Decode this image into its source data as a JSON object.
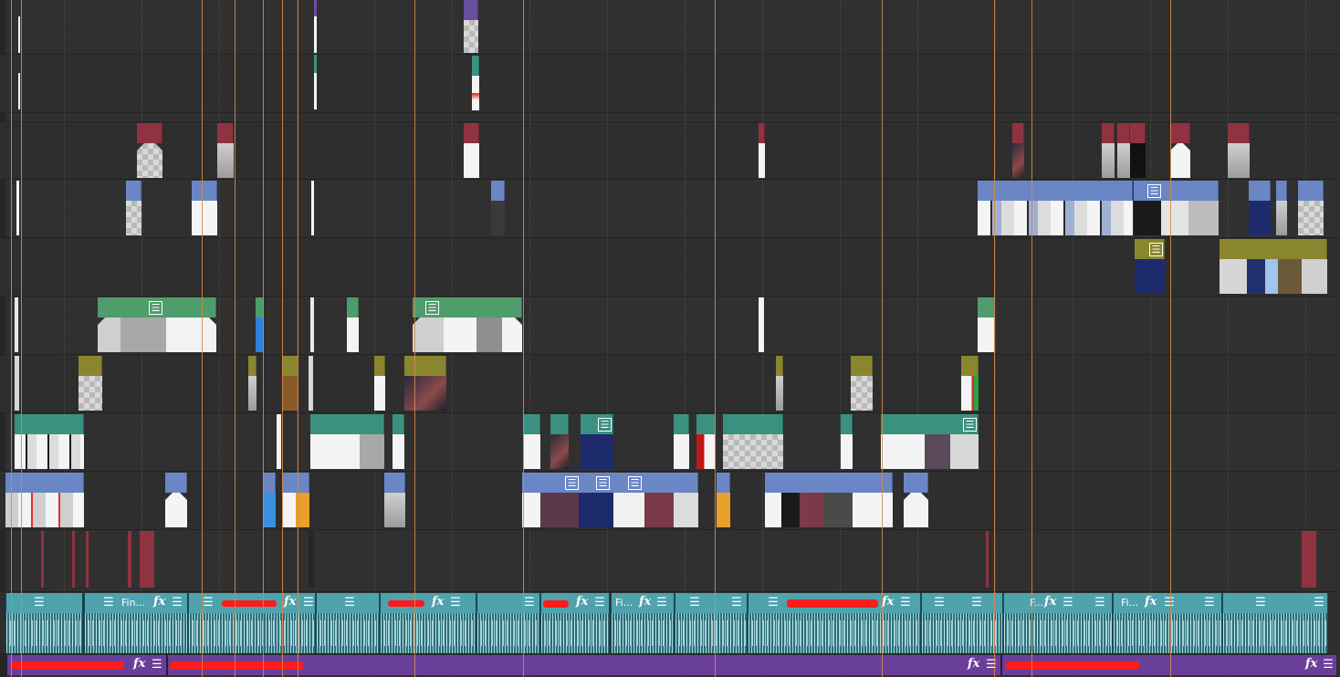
{
  "icons": {
    "clip_menu": "menu-icon",
    "clip_effects": "fx-icon"
  },
  "glyphs": {
    "menu": "☰",
    "fx": "fx"
  },
  "colors": {
    "background": "#303030",
    "marker": "#d2894a",
    "video_header_blue": "#6a86c4",
    "video_header_green": "#4f9c6c",
    "video_header_olive": "#8a8630",
    "video_header_teal": "#3b9180",
    "video_header_maroon": "#8f3341",
    "audio_header": "#4fa3ad",
    "effects_track": "#6a3f99",
    "redaction": "#ff1b1b"
  },
  "audio": {
    "clip_names": [
      "Fin...",
      "Fi...",
      "F...",
      "Fi..."
    ]
  }
}
